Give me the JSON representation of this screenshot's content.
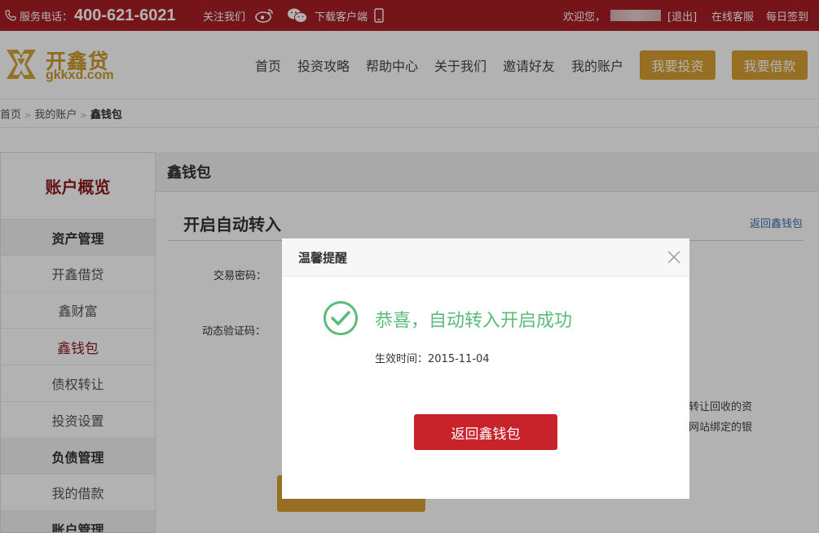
{
  "topbar": {
    "phone_label": "服务电话：",
    "phone_number": "400-621-6021",
    "follow_label": "关注我们",
    "download_label": "下载客户端",
    "welcome_label": "欢迎您，",
    "logout_label": "[退出]",
    "service_label": "在线客服",
    "checkin_label": "每日签到"
  },
  "logo": {
    "cn": "开鑫贷",
    "en": "gkkxd.com"
  },
  "nav": {
    "items": [
      "首页",
      "投资攻略",
      "帮助中心",
      "关于我们",
      "邀请好友",
      "我的账户"
    ],
    "invest_button": "我要投资",
    "borrow_button": "我要借款"
  },
  "breadcrumb": {
    "home": "首页",
    "account": "我的账户",
    "current": "鑫钱包",
    "separator": ">"
  },
  "sidebar": {
    "title": "账户概览",
    "group_asset": "资产管理",
    "items_asset": [
      "开鑫借贷",
      "鑫财富",
      "鑫钱包",
      "债权转让",
      "投资设置"
    ],
    "group_debt": "负债管理",
    "items_debt": [
      "我的借款"
    ],
    "group_account": "账户管理"
  },
  "main": {
    "header": "鑫钱包",
    "subtitle": "开启自动转入",
    "back_link": "返回鑫钱包",
    "label_password": "交易密码：",
    "label_code": "动态验证码：",
    "bg_text_1": "转让回收的资",
    "bg_text_2": "网站绑定的银"
  },
  "modal": {
    "title": "温馨提醒",
    "message": "恭喜，自动转入开启成功",
    "effect_time": "生效时间：2015-11-04",
    "button": "返回鑫钱包"
  },
  "colors": {
    "topbar": "#a91f24",
    "gold": "#d89f32",
    "success": "#5bbc79",
    "danger": "#c8232b"
  }
}
